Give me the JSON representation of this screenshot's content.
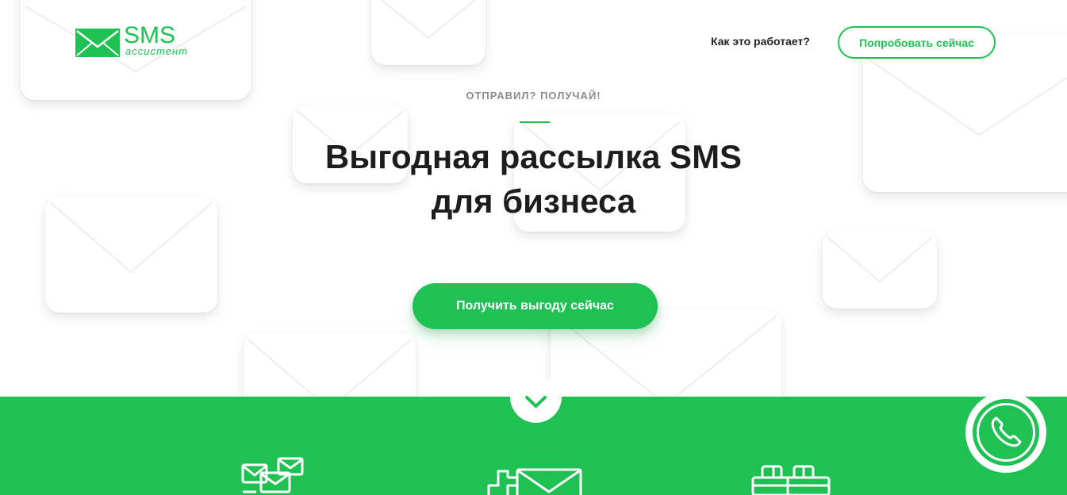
{
  "header": {
    "logo": {
      "main_text": "SMS",
      "sub_text": "ассистент",
      "icon": "envelope-logo-icon"
    },
    "nav_link_label": "Как это работает?",
    "try_button_label": "Попробовать сейчас"
  },
  "hero": {
    "overline": "ОТПРАВИЛ? ПОЛУЧАЙ!",
    "headline_line1": "Выгодная рассылка SMS",
    "headline_line2": "для бизнеса",
    "cta_label": "Получить выгоду сейчас"
  },
  "band": {
    "scroll_icon": "chevron-down-icon",
    "feature_icons": [
      "multiple-envelopes-icon",
      "envelope-plus-icon",
      "gift-icon"
    ],
    "phone_icon": "phone-icon"
  },
  "colors": {
    "accent": "#1fc153",
    "text_dark": "#1d1d1d",
    "text_muted": "#8a8a8a",
    "background": "#ffffff"
  }
}
